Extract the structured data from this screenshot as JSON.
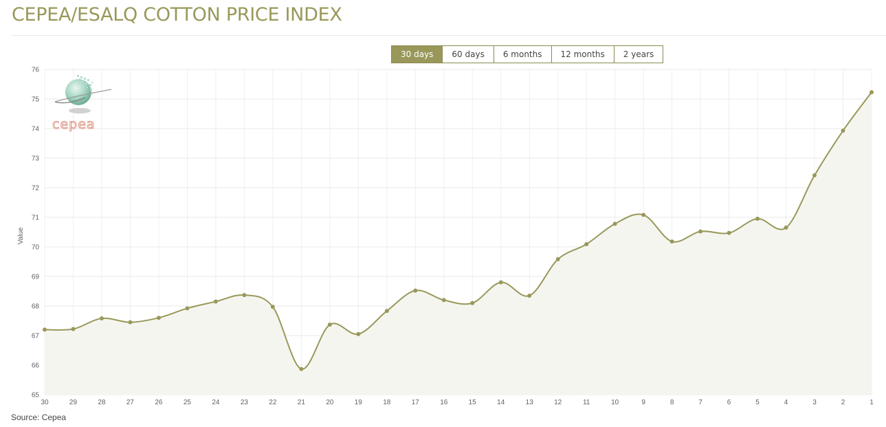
{
  "page": {
    "title": "CEPEA/ESALQ COTTON PRICE INDEX",
    "source": "Source: Cepea"
  },
  "range_tabs": [
    {
      "label": "30 days",
      "active": true
    },
    {
      "label": "60 days",
      "active": false
    },
    {
      "label": "6 months",
      "active": false
    },
    {
      "label": "12 months",
      "active": false
    },
    {
      "label": "2 years",
      "active": false
    }
  ],
  "logo": {
    "text": "cepea"
  },
  "colors": {
    "accent": "#99985a",
    "area_fill": "#f5f5f0",
    "logo_text": "#e2a193"
  },
  "chart_data": {
    "type": "area",
    "title": "",
    "xlabel": "",
    "ylabel": "Value",
    "ylim": [
      65,
      76
    ],
    "y_ticks": [
      "65",
      "66",
      "67",
      "68",
      "69",
      "70",
      "71",
      "72",
      "73",
      "74",
      "75",
      "76"
    ],
    "categories": [
      "30",
      "29",
      "28",
      "27",
      "26",
      "25",
      "24",
      "23",
      "22",
      "21",
      "20",
      "19",
      "18",
      "17",
      "16",
      "15",
      "14",
      "13",
      "12",
      "11",
      "10",
      "9",
      "8",
      "7",
      "6",
      "5",
      "4",
      "3",
      "2",
      "1"
    ],
    "values": [
      67.2,
      67.22,
      67.58,
      67.45,
      67.6,
      67.92,
      68.15,
      68.37,
      67.97,
      65.87,
      67.37,
      67.05,
      67.83,
      68.52,
      68.2,
      68.1,
      68.8,
      68.35,
      69.58,
      70.09,
      70.78,
      71.08,
      70.18,
      70.52,
      70.47,
      70.95,
      70.65,
      72.42,
      73.93,
      75.23
    ],
    "grid": true,
    "legend": "none"
  }
}
